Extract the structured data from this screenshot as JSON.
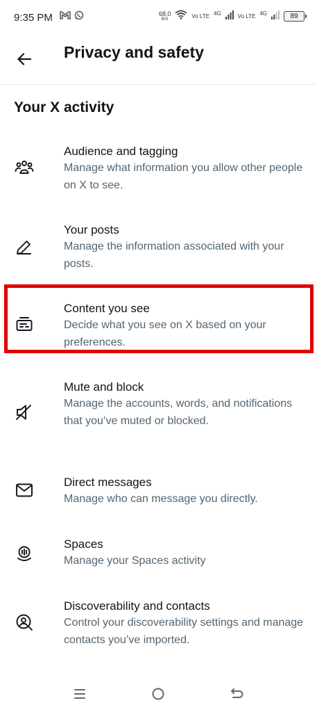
{
  "status_bar": {
    "time": "9:35 PM",
    "net_speed_value": "68.0",
    "net_speed_unit": "B/S",
    "sim1_label": "Vo LTE",
    "sim1_network": "4G",
    "sim2_label": "Vo LTE",
    "sim2_network": "4G",
    "battery": "89",
    "icons": [
      "gmail-icon",
      "whatsapp-icon",
      "wifi-icon",
      "signal-icon",
      "battery-icon"
    ]
  },
  "header": {
    "back_icon": "arrow-left-icon",
    "title": "Privacy and safety"
  },
  "section": {
    "title": "Your X activity"
  },
  "items": [
    {
      "icon": "people-icon",
      "label": "Audience and tagging",
      "description": "Manage what information you allow other people on X to see."
    },
    {
      "icon": "pencil-icon",
      "label": "Your posts",
      "description": "Manage the information associated with your posts."
    },
    {
      "icon": "content-card-icon",
      "label": "Content you see",
      "description": "Decide what you see on X based on your preferences."
    },
    {
      "icon": "muted-speaker-icon",
      "label": "Mute and block",
      "description": "Manage the accounts, words, and notifications that you’ve muted or blocked."
    },
    {
      "icon": "envelope-icon",
      "label": "Direct messages",
      "description": "Manage who can message you directly."
    },
    {
      "icon": "spaces-icon",
      "label": "Spaces",
      "description": "Manage your Spaces activity"
    },
    {
      "icon": "contact-search-icon",
      "label": "Discoverability and contacts",
      "description": "Control your discoverability settings and manage contacts you’ve imported."
    }
  ],
  "highlight": {
    "color": "#e00000",
    "target": "Content you see"
  },
  "nav_bar": {
    "icons": [
      "menu-icon",
      "home-circle-icon",
      "back-icon"
    ]
  },
  "colors": {
    "primary_text": "#0f1419",
    "secondary_text": "#536471",
    "divider": "#e6e9ec",
    "highlight": "#e00000"
  }
}
